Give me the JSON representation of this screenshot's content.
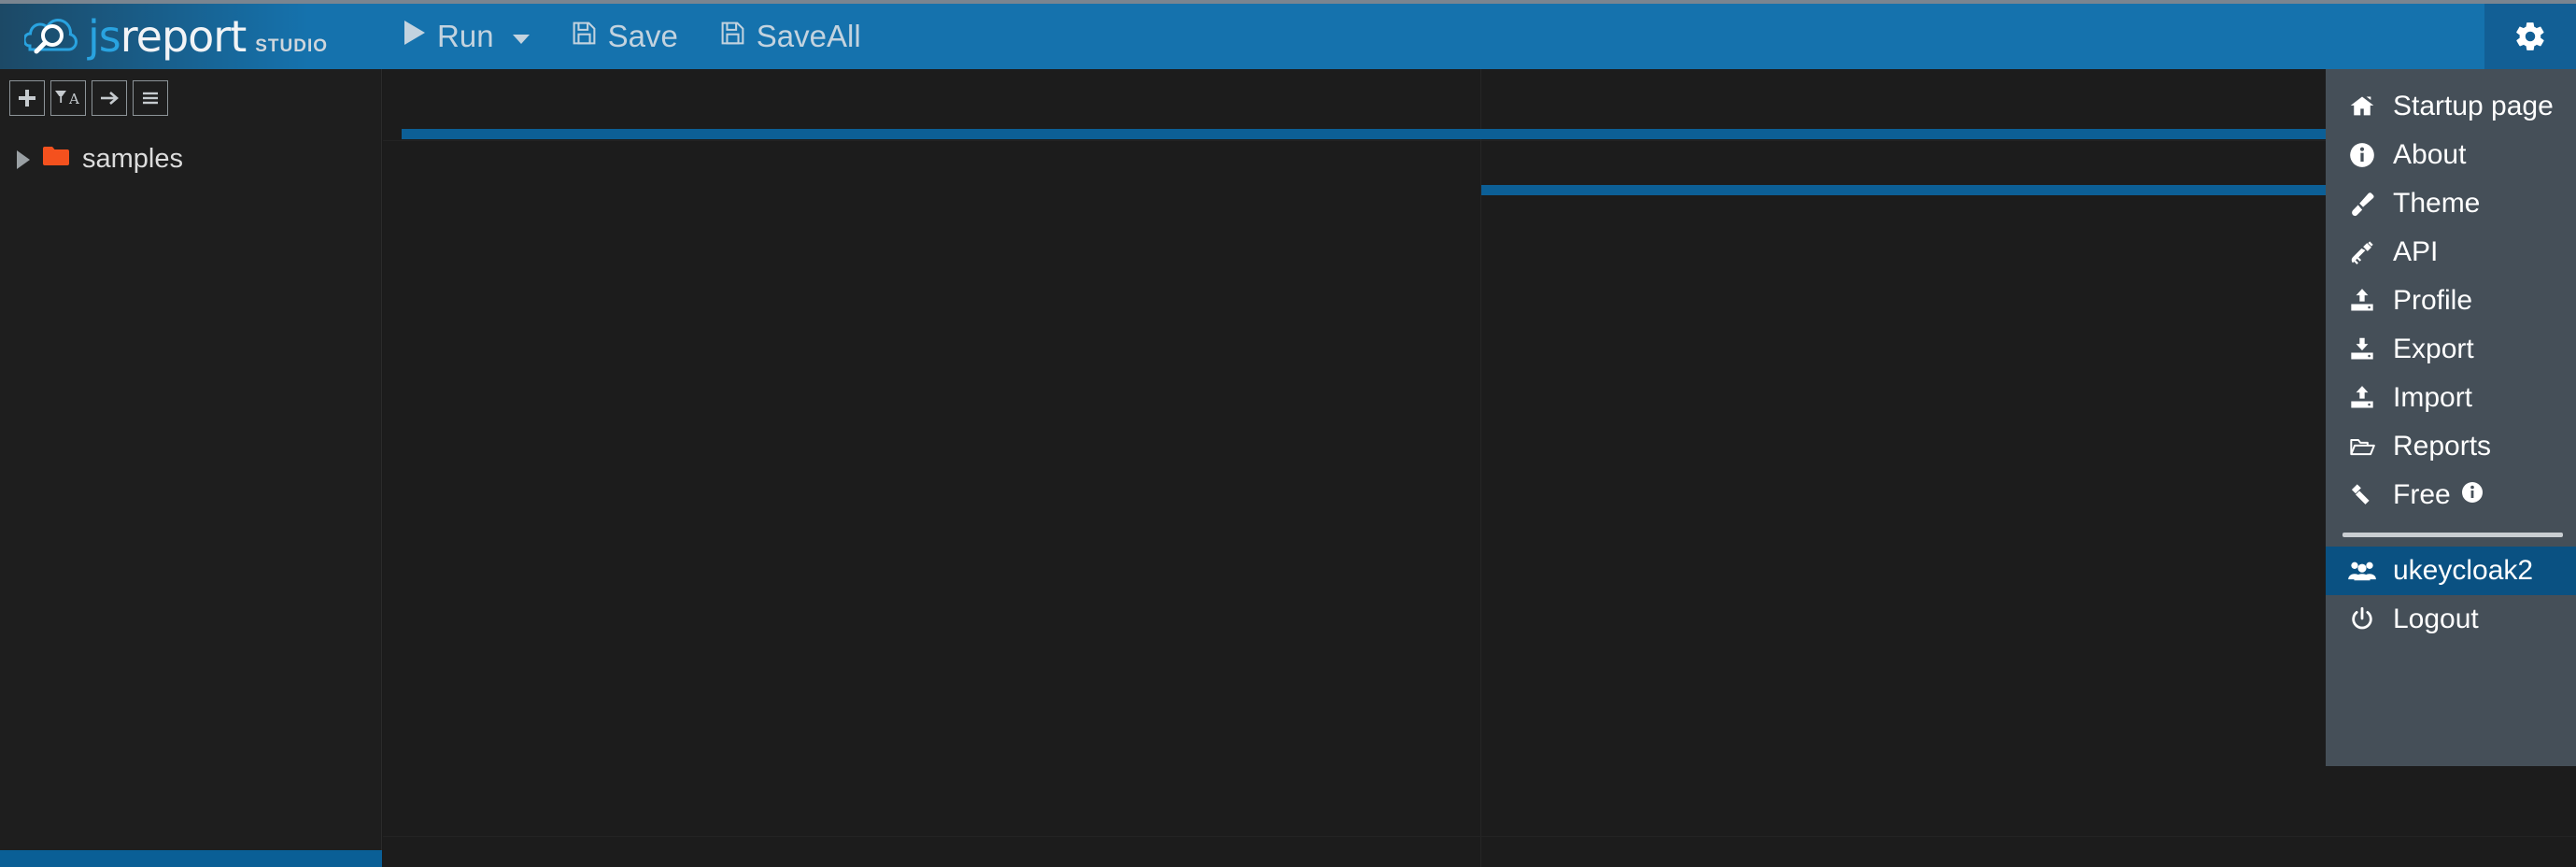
{
  "app": {
    "brand_js": "js",
    "brand_report": "report",
    "brand_studio": "STUDIO"
  },
  "toolbar": {
    "run_label": "Run",
    "run_icon": "play-icon",
    "run_caret_icon": "chevron-down-icon",
    "save_label": "Save",
    "save_icon": "floppy-disk-icon",
    "save_all_label": "SaveAll",
    "save_all_icon": "floppy-disk-icon",
    "gear_icon": "gear-icon"
  },
  "sidebar": {
    "buttons": [
      {
        "name": "new-entity-button",
        "icon": "plus-icon",
        "title": "+"
      },
      {
        "name": "filter-sort-button",
        "icon": "filter-sort-icon",
        "title": "Filter"
      },
      {
        "name": "collapse-button",
        "icon": "arrow-right-icon",
        "title": "Collapse"
      },
      {
        "name": "menu-button",
        "icon": "hamburger-icon",
        "title": "Menu"
      }
    ],
    "tree": [
      {
        "name": "tree-item-samples",
        "label": "samples",
        "icon": "folder-icon",
        "expanded": false
      }
    ]
  },
  "menu": {
    "items": [
      {
        "label": "Startup page",
        "icon": "home-icon",
        "name": "menu-item-startup-page"
      },
      {
        "label": "About",
        "icon": "info-circle-icon",
        "name": "menu-item-about"
      },
      {
        "label": "Theme",
        "icon": "paint-brush-icon",
        "name": "menu-item-theme"
      },
      {
        "label": "API",
        "icon": "plug-icon",
        "name": "menu-item-api"
      },
      {
        "label": "Profile",
        "icon": "upload-drive-icon",
        "name": "menu-item-profile"
      },
      {
        "label": "Export",
        "icon": "download-drive-icon",
        "name": "menu-item-export"
      },
      {
        "label": "Import",
        "icon": "upload-drive-icon",
        "name": "menu-item-import"
      },
      {
        "label": "Reports",
        "icon": "folder-open-icon",
        "name": "menu-item-reports"
      },
      {
        "label": "Free",
        "icon": "gavel-icon",
        "name": "menu-item-free",
        "badge_icon": "info-circle-icon"
      }
    ],
    "user": {
      "label": "ukeycloak2",
      "icon": "users-icon",
      "name": "menu-item-user",
      "active": true
    },
    "logout": {
      "label": "Logout",
      "icon": "power-icon",
      "name": "menu-item-logout"
    }
  },
  "colors": {
    "brand_blue": "#1572ad",
    "accent_blue": "#0c5f96",
    "menu_bg": "#454f58",
    "menu_active": "#0a5182",
    "folder_orange": "#f4511e",
    "app_bg": "#1a1a1a"
  }
}
